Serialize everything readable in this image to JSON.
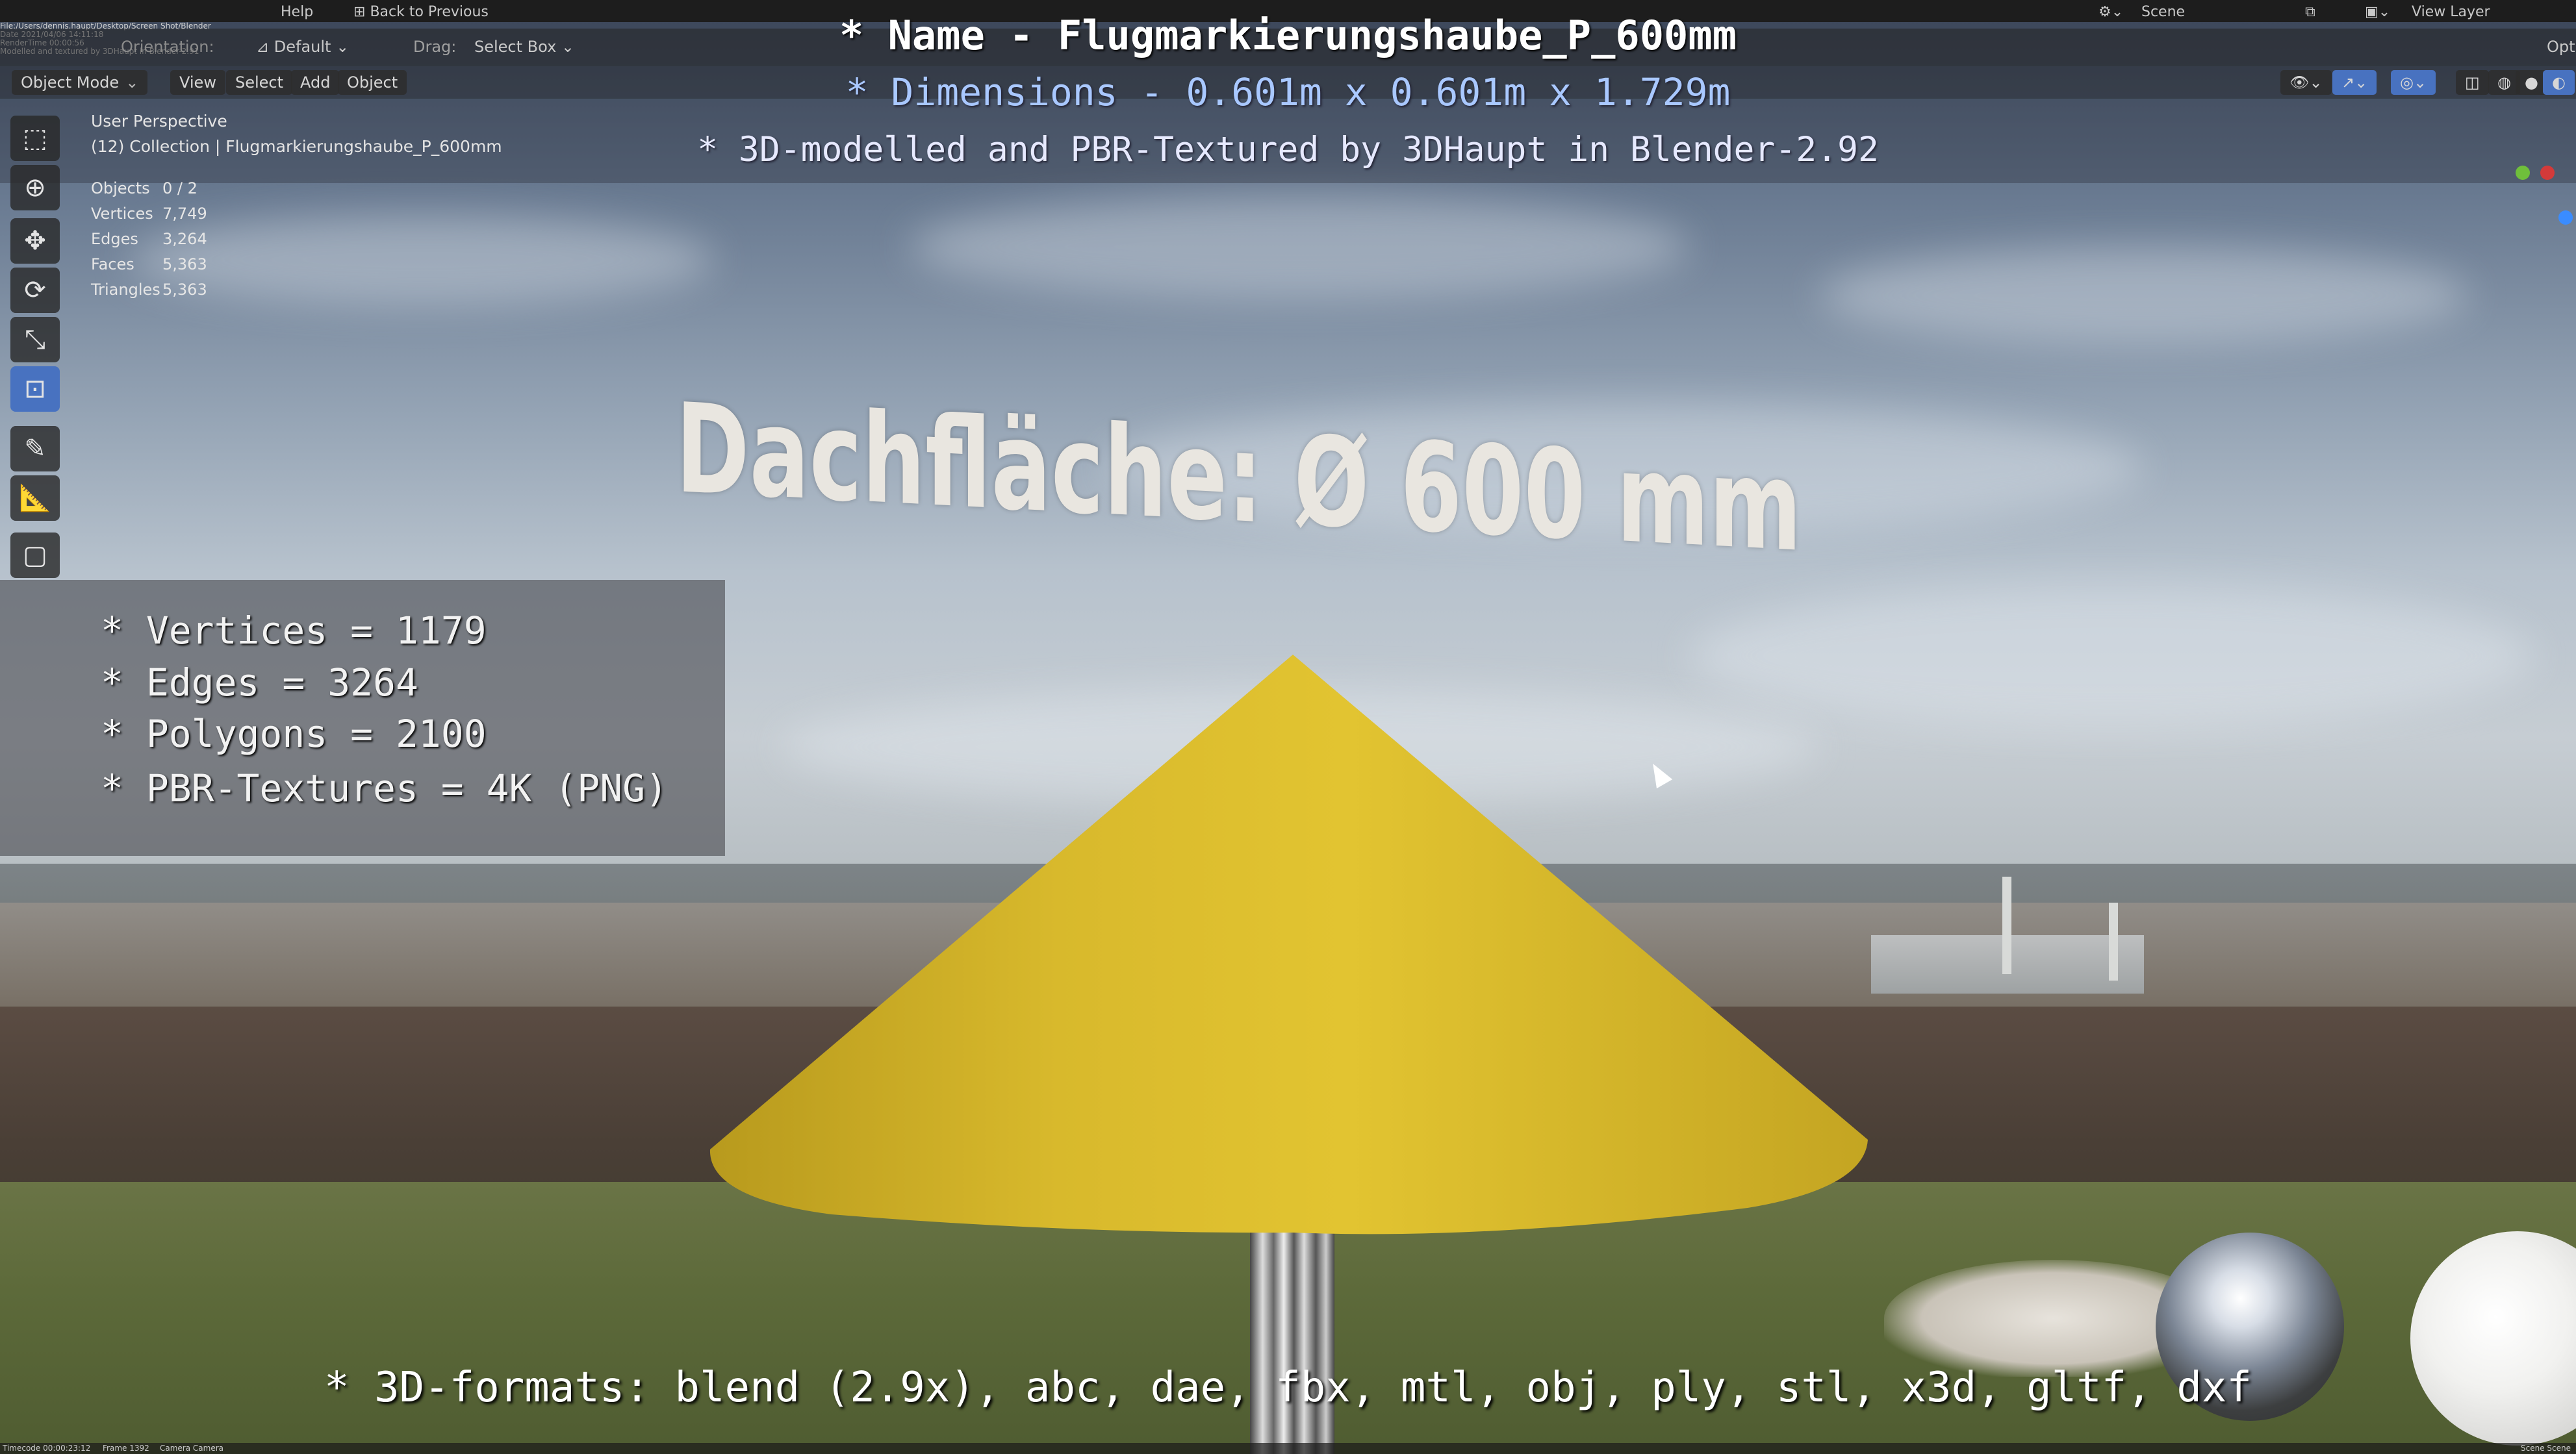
{
  "titles": {
    "name": "* Name - Flugmarkierungshaube_P_600mm",
    "dimensions": "* Dimensions -  0.601m x 0.601m x 1.729m",
    "credit": "* 3D-modelled and PBR-Textured by 3DHaupt in Blender-2.92"
  },
  "topbar": {
    "help": "Help",
    "back": "Back to Previous",
    "scene": "Scene",
    "view_layer": "View Layer",
    "orientation": "Orientation:",
    "default": "Default",
    "drag_label": "Drag:",
    "drag_value": "Select Box",
    "options": "Opti"
  },
  "header": {
    "mode": "Object Mode",
    "menus": [
      "View",
      "Select",
      "Add",
      "Object"
    ]
  },
  "viewport": {
    "perspective": "User Perspective",
    "collection": "(12) Collection | Flugmarkierungshaube_P_600mm"
  },
  "stats": [
    {
      "label": "Objects",
      "value": "0 / 2"
    },
    {
      "label": "Vertices",
      "value": "7,749"
    },
    {
      "label": "Edges",
      "value": "3,264"
    },
    {
      "label": "Faces",
      "value": "5,363"
    },
    {
      "label": "Triangles",
      "value": "5,363"
    }
  ],
  "sign_text": "Dachfläche: Ø 600 mm",
  "specs": [
    "* Vertices = 1179",
    "* Edges = 3264",
    "* Polygons = 2100",
    "* PBR-Textures = 4K (PNG)"
  ],
  "formats": "* 3D-formats: blend (2.9x), abc, dae, fbx, mtl, obj, ply, stl, x3d, gltf, dxf",
  "bottombar": {
    "timecode": "Timecode 00:00:23:12",
    "frame": "Frame 1392",
    "camera": "Camera Camera",
    "scene": "Scene Scene"
  },
  "burnin": "File:/Users/dennis.haupt/Desktop/Screen Shot/Blender\nDate 2021/04/06 14:11:18\nRenderTime 00:00:56\nModelled and textured by 3DHaupt in Blender-2.91",
  "colors": {
    "cone": "#d9b82a",
    "active_tool": "#4872c0",
    "dimensions_text": "#a9c8ff"
  },
  "tools": [
    "select-box-icon",
    "cursor-icon",
    "move-icon",
    "rotate-icon",
    "scale-icon",
    "transform-icon",
    "annotate-icon",
    "measure-icon",
    "add-cube-icon"
  ]
}
